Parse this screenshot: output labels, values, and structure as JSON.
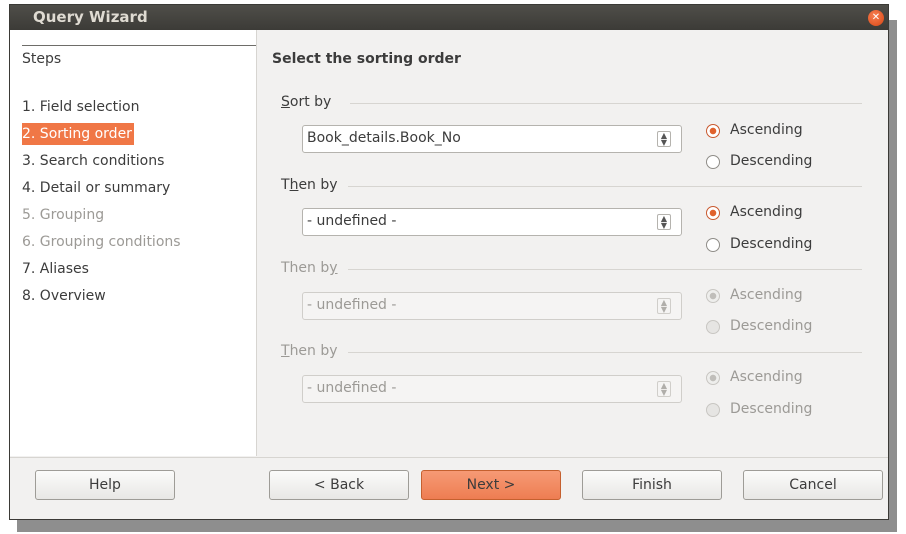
{
  "window": {
    "title": "Query Wizard"
  },
  "steps": {
    "title": "Steps",
    "items": [
      {
        "label": "1. Field selection",
        "state": "normal"
      },
      {
        "label": "2. Sorting order",
        "state": "selected"
      },
      {
        "label": "3. Search conditions",
        "state": "normal"
      },
      {
        "label": "4. Detail or summary",
        "state": "normal"
      },
      {
        "label": "5. Grouping",
        "state": "disabled"
      },
      {
        "label": "6. Grouping conditions",
        "state": "disabled"
      },
      {
        "label": "7. Aliases",
        "state": "normal"
      },
      {
        "label": "8. Overview",
        "state": "normal"
      }
    ]
  },
  "main": {
    "title": "Select the sorting order",
    "sorts": [
      {
        "label_pre": "",
        "label_u": "S",
        "label_post": "ort by",
        "value": "Book_details.Book_No",
        "order": "Ascending",
        "enabled": true
      },
      {
        "label_pre": "T",
        "label_u": "h",
        "label_post": "en by",
        "value": "- undefined -",
        "order": "Ascending",
        "enabled": true
      },
      {
        "label_pre": "Then b",
        "label_u": "y",
        "label_post": "",
        "value": "- undefined -",
        "order": "Ascending",
        "enabled": false
      },
      {
        "label_pre": "",
        "label_u": "T",
        "label_post": "hen by",
        "value": "- undefined -",
        "order": "Ascending",
        "enabled": false
      }
    ],
    "radio_labels": {
      "asc": "Ascending",
      "desc": "Descending"
    }
  },
  "buttons": {
    "help": "Help",
    "back": "< Back",
    "next": "Next >",
    "finish": "Finish",
    "cancel": "Cancel"
  },
  "colors": {
    "accent": "#f07746",
    "titlebar": "#3c3b37"
  },
  "icons": {
    "close": "close-icon",
    "spin": "spin-arrows-icon"
  }
}
